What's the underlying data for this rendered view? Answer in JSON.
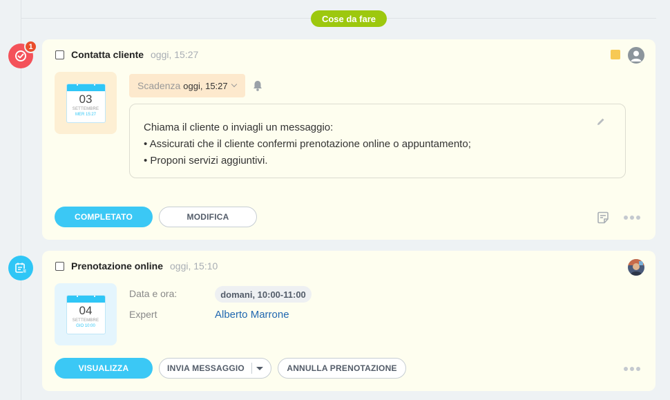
{
  "section": {
    "label": "Cose da fare"
  },
  "badge": {
    "count": "1"
  },
  "colors": {
    "accent": "#3bc8f5",
    "section_green": "#9dc80e",
    "todo_red": "#f4525a",
    "booking_blue": "#2fc6f6",
    "badge_red": "#ea4d2b"
  },
  "icons": {
    "todo": "check-circle-icon",
    "booking": "calendar-list-icon",
    "bell": "bell-icon",
    "pencil": "pencil-icon",
    "note": "note-icon",
    "more": "more-dots-icon",
    "user": "user-icon",
    "chevron": "chevron-down-icon"
  },
  "todo_card": {
    "title": "Contatta cliente",
    "time": "oggi, 15:27",
    "calendar": {
      "day": "03",
      "month": "SETTEMBRE",
      "weekday_time": "MER 15:27"
    },
    "deadline": {
      "label": "Scadenza",
      "value": "oggi, 15:27"
    },
    "description": {
      "line1": "Chiama il cliente o inviagli un messaggio:",
      "line2": "• Assicurati che il cliente confermi prenotazione online o appuntamento;",
      "line3": "• Proponi servizi aggiuntivi."
    },
    "buttons": {
      "complete": "COMPLETATO",
      "edit": "MODIFICA"
    }
  },
  "booking_card": {
    "title": "Prenotazione online",
    "time": "oggi, 15:10",
    "calendar": {
      "day": "04",
      "month": "SETTEMBRE",
      "weekday_time": "GIO 10:00"
    },
    "date_label": "Data e ora:",
    "date_value": "domani, 10:00-11:00",
    "expert_label": "Expert",
    "expert_name": "Alberto Marrone",
    "buttons": {
      "view": "VISUALIZZA",
      "send_message": "INVIA MESSAGGIO",
      "cancel_booking": "ANNULLA PRENOTAZIONE"
    }
  }
}
